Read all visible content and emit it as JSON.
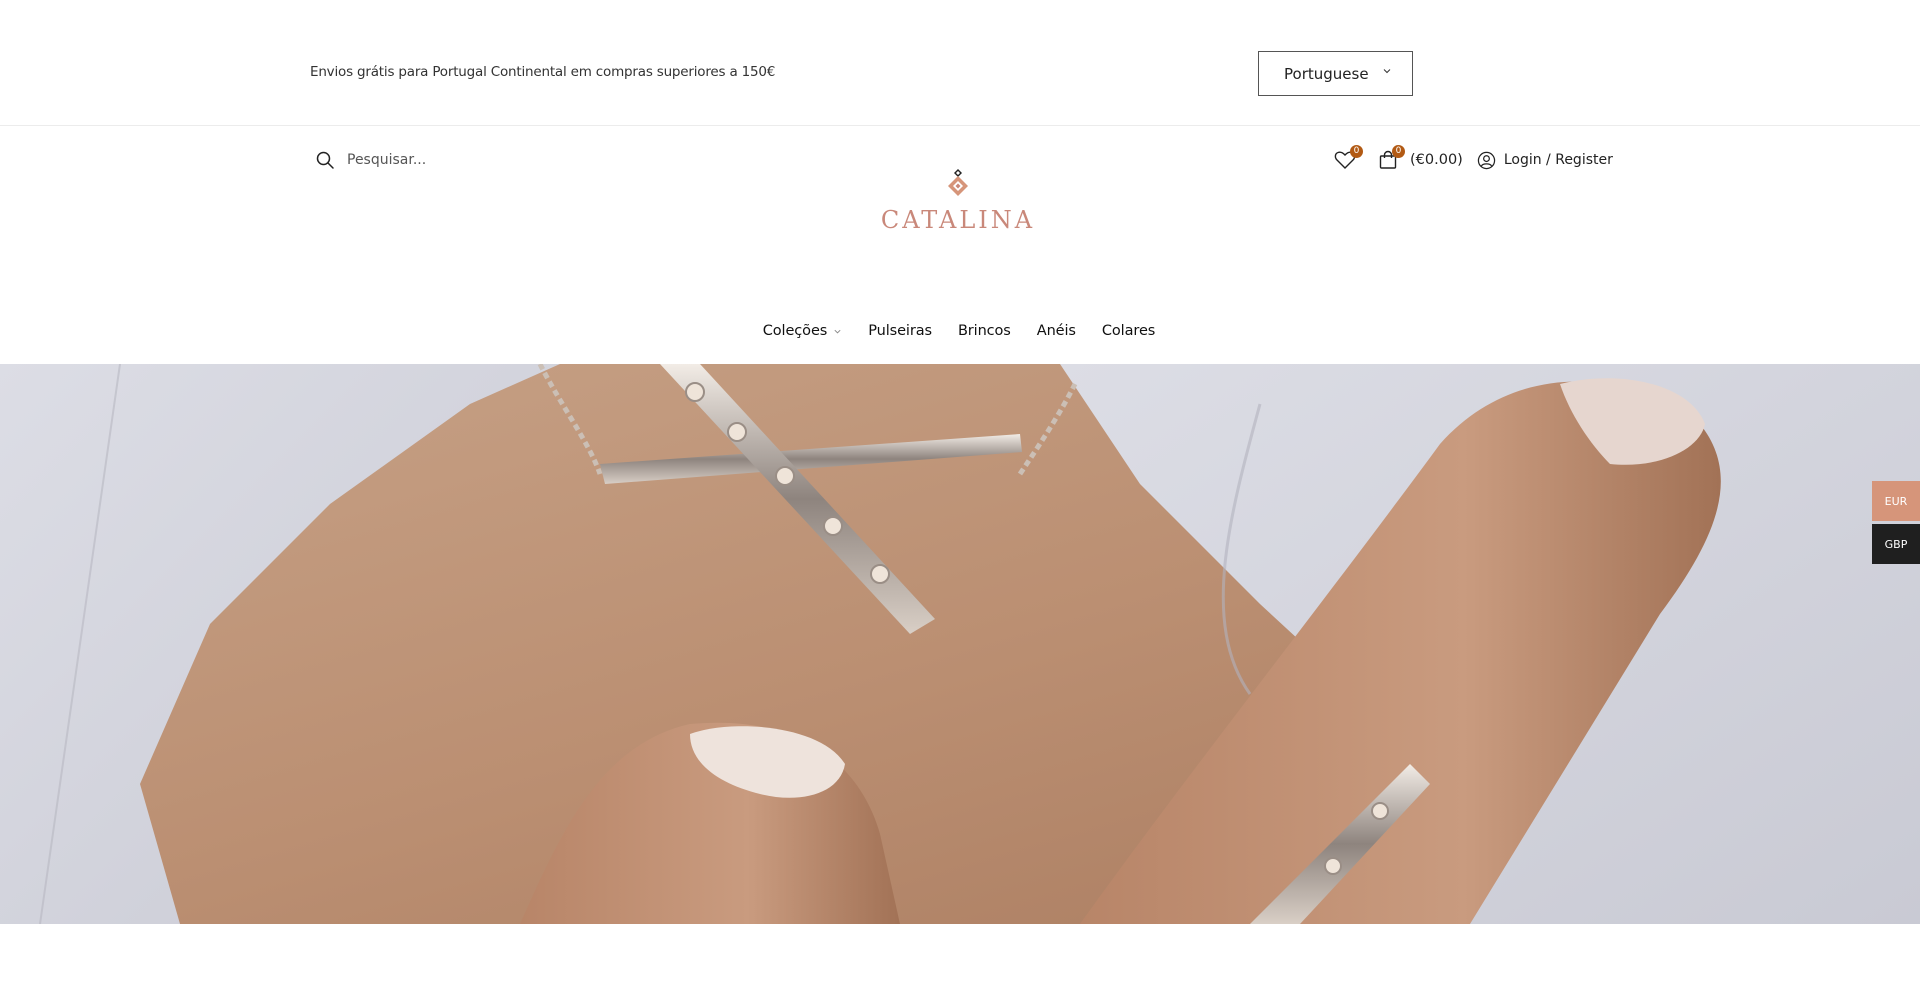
{
  "topbar": {
    "shipping_text": "Envios grátis para Portugal Continental em compras superiores a 150€",
    "language": "Portuguese"
  },
  "header": {
    "search_placeholder": "Pesquisar...",
    "logo_text": "CATALINA",
    "wishlist_count": "0",
    "cart_count": "0",
    "cart_total": "(€0.00)",
    "login_label": "Login / Register"
  },
  "nav": {
    "items": [
      {
        "label": "Coleções",
        "has_dropdown": true
      },
      {
        "label": "Pulseiras",
        "has_dropdown": false
      },
      {
        "label": "Brincos",
        "has_dropdown": false
      },
      {
        "label": "Anéis",
        "has_dropdown": false
      },
      {
        "label": "Colares",
        "has_dropdown": false
      }
    ]
  },
  "hero": {
    "image": "close-up of a necklace with a diagonal cross bar pendant and a ring on a finger"
  },
  "currency": {
    "options": [
      "EUR",
      "GBP"
    ],
    "active": "EUR"
  },
  "colors": {
    "brand": "#c9887a",
    "badge": "#b25a14",
    "currency_active": "#d6957a",
    "currency_inactive": "#1f1f1f"
  }
}
